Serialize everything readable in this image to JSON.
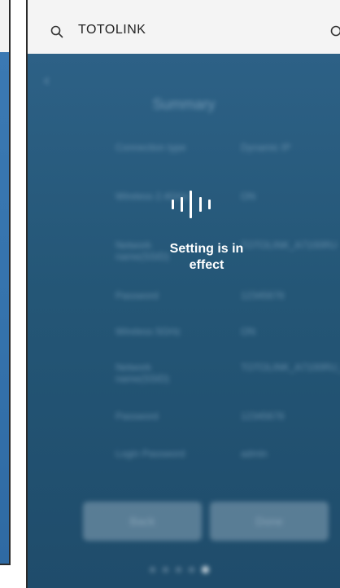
{
  "search": {
    "query": "TOTOLINK",
    "icon": "search-icon",
    "right_icon": "search-icon"
  },
  "screen": {
    "back_icon": "chevron-left-icon",
    "title": "Summary",
    "rows": [
      {
        "label": "Connection type",
        "value": "Dynamic IP"
      },
      {
        "label": "Wireless 2.4GHz",
        "value": "ON"
      },
      {
        "label": "Network name(SSID)",
        "value": "TOTOLINK_A7100RU"
      },
      {
        "label": "Password",
        "value": "12345678"
      },
      {
        "label": "Wireless 5GHz",
        "value": "ON"
      },
      {
        "label": "Network name(SSID)",
        "value": "TOTOLINK_A7100RU_5G"
      },
      {
        "label": "Password",
        "value": "12345678"
      },
      {
        "label": "Login Password",
        "value": "admin"
      }
    ],
    "back_button": "Back",
    "done_button": "Done",
    "page_dots_total": 5,
    "page_dots_active": 5
  },
  "overlay": {
    "status_line1": "Setting is in",
    "status_line2": "effect",
    "loading_icon": "audio-wave-loading-icon"
  },
  "colors": {
    "background_top": "#2d6186",
    "background_bottom": "#1f4c6b",
    "overlay_text": "#ffffff"
  }
}
